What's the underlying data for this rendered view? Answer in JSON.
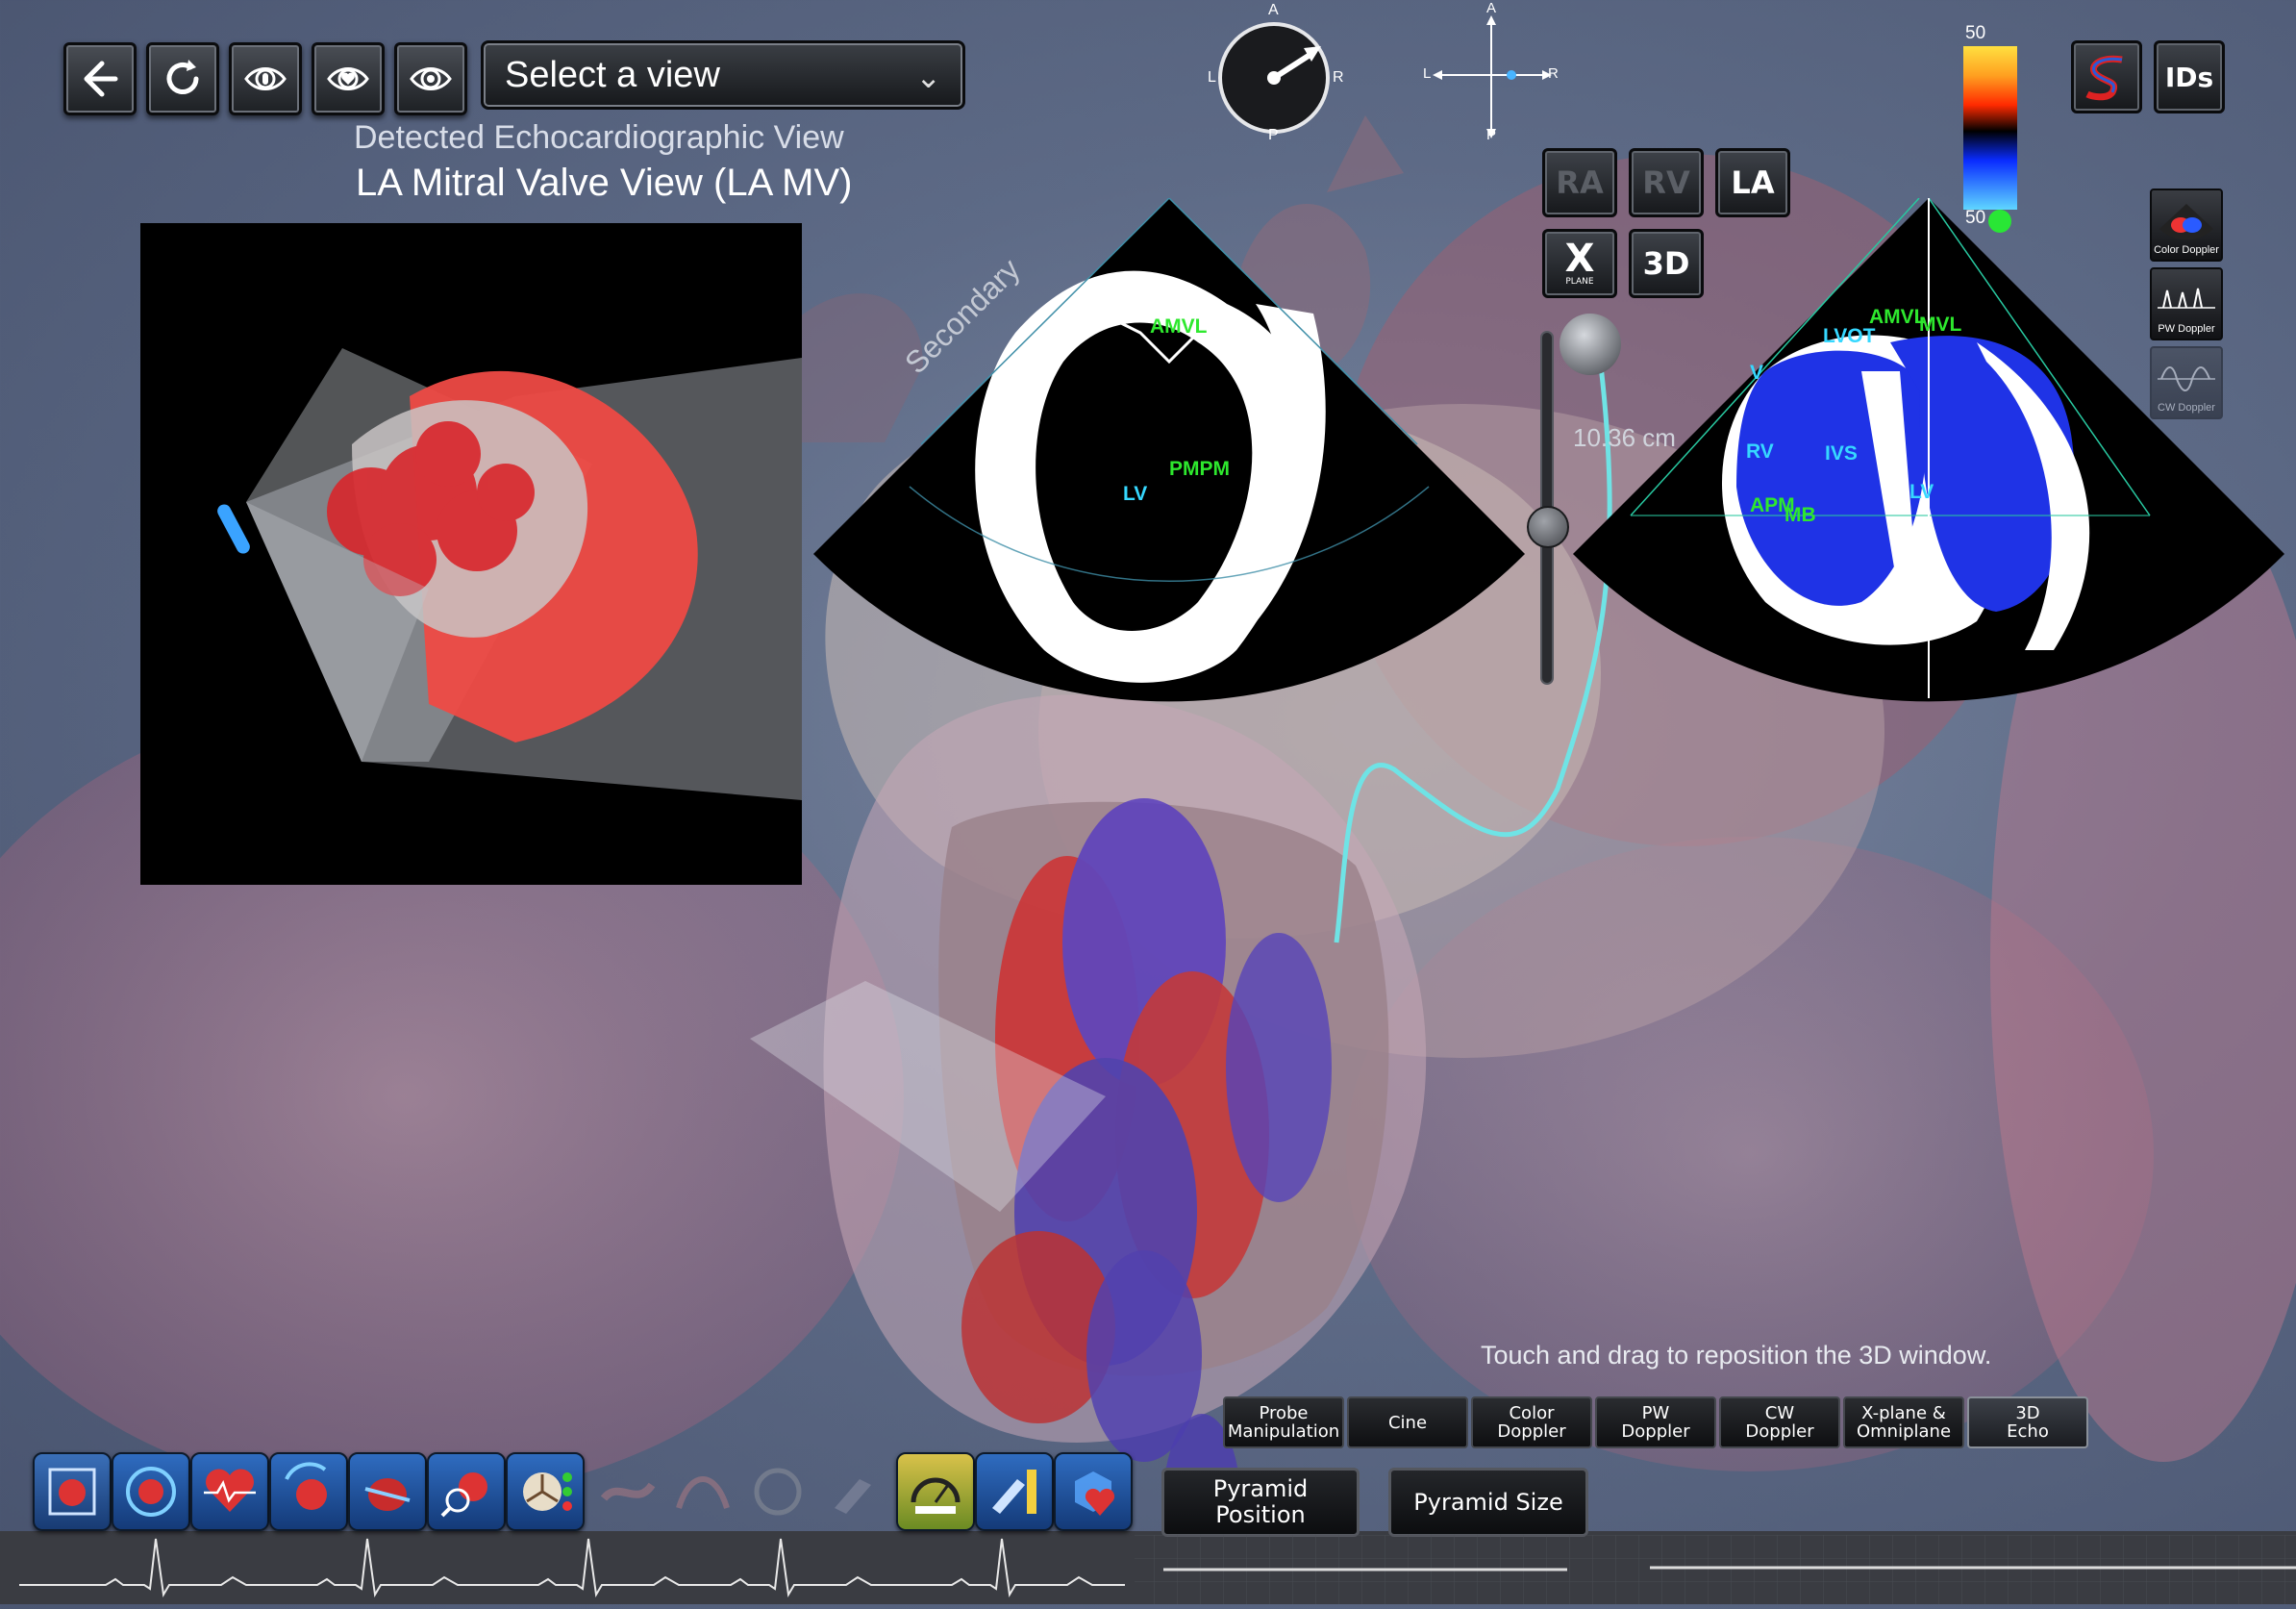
{
  "toolbar": {
    "back_icon": "back-arrow-icon",
    "reset_icon": "refresh-icon",
    "view_buttons": [
      "eye-body-icon",
      "eye-heart-icon",
      "eye-icon"
    ],
    "view_select": {
      "value": "Select a view",
      "icon": "chevron-down-icon"
    }
  },
  "detected": {
    "subtitle": "Detected Echocardiographic View",
    "title": "LA Mitral Valve View (LA MV)"
  },
  "orientation": {
    "compass": {
      "top": "A",
      "bottom": "P",
      "left": "L",
      "right": "R"
    },
    "crosshair": {
      "top": "A",
      "bottom": "P",
      "left": "L",
      "right": "R"
    }
  },
  "color_scale": {
    "top_value": "50",
    "bottom_value": "50",
    "colors": [
      "#ffe040",
      "#ff2a00",
      "#000000",
      "#0a2cff",
      "#5fd6ff"
    ]
  },
  "view_buttons": [
    {
      "label": "RA",
      "active": false
    },
    {
      "label": "RV",
      "active": false
    },
    {
      "label": "LA",
      "active": true
    },
    {
      "label": "X",
      "sub": "PLANE",
      "active": true
    },
    {
      "label": "3D",
      "active": true
    }
  ],
  "top_right_buttons": [
    {
      "icon": "s-logo-icon"
    },
    {
      "label": "IDs"
    }
  ],
  "doppler_modes": [
    {
      "label": "Color Doppler",
      "active": true
    },
    {
      "label": "PW Doppler",
      "active": true
    },
    {
      "label": "CW Doppler",
      "active": false
    }
  ],
  "depth": {
    "label": "10.36 cm",
    "fraction": 0.55
  },
  "secondary_label": "Secondary",
  "echo_left_labels": [
    "AMVL",
    "PMPM",
    "LV"
  ],
  "echo_right_labels": [
    "LVOT",
    "AMVL",
    "MVL",
    "RV",
    "IVS",
    "LV",
    "APM",
    "MB",
    "V"
  ],
  "hint": "Touch and drag to reposition the 3D window.",
  "bottom_tabs": [
    {
      "label": "Probe\nManipulation",
      "active": false
    },
    {
      "label": "Cine",
      "active": false
    },
    {
      "label": "Color\nDoppler",
      "active": false
    },
    {
      "label": "PW\nDoppler",
      "active": false
    },
    {
      "label": "CW\nDoppler",
      "active": false
    },
    {
      "label": "X-plane &\nOmniplane",
      "active": false
    },
    {
      "label": "3D\nEcho",
      "active": true
    }
  ],
  "pyramid_buttons": [
    {
      "label": "Pyramid\nPosition"
    },
    {
      "label": "Pyramid Size"
    }
  ],
  "module_icons": [
    "heart-box-icon",
    "heart-ring-icon",
    "heart-pulse-icon",
    "heart-rotate-icon",
    "heart-section-icon",
    "heart-magnify-icon",
    "heart-valve-icon",
    "valve-check-icon",
    "vessel-icon",
    "curve-icon",
    "gauge-icon",
    "probe-icon"
  ],
  "right_module_icons": [
    "gauge-meter-icon",
    "probe-ruler-icon",
    "cube-heart-icon"
  ]
}
